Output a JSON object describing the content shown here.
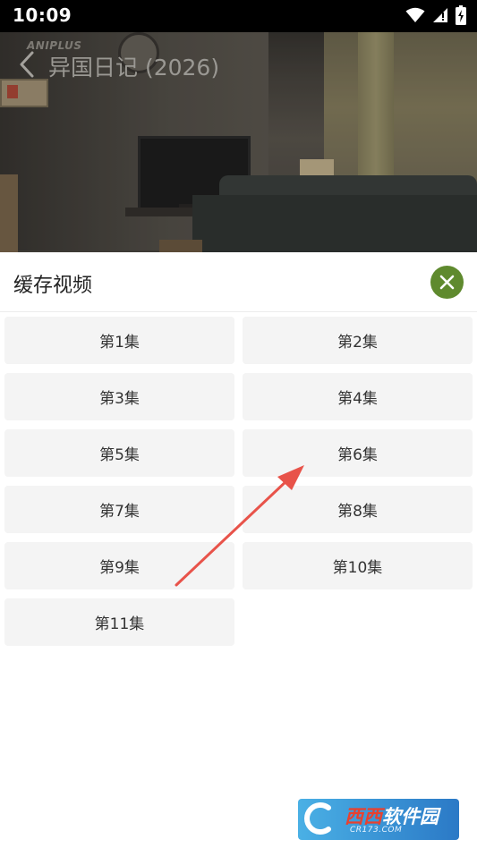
{
  "status_bar": {
    "time": "10:09",
    "icons": [
      "wifi-icon",
      "signal-icon",
      "battery-icon"
    ]
  },
  "header": {
    "brand": "ANIPLUS",
    "title": "异国日记 (2026)",
    "back_icon": "chevron-left-icon"
  },
  "sheet": {
    "title": "缓存视频",
    "close_icon": "close-icon",
    "accent_color": "#5f8a2e",
    "episodes": [
      "第1集",
      "第2集",
      "第3集",
      "第4集",
      "第5集",
      "第6集",
      "第7集",
      "第8集",
      "第9集",
      "第10集",
      "第11集"
    ]
  },
  "annotation": {
    "color": "#e8534a",
    "icon": "arrow-icon"
  },
  "watermark": {
    "text_a": "西西",
    "text_b": "软件园",
    "url": "CR173.COM"
  }
}
